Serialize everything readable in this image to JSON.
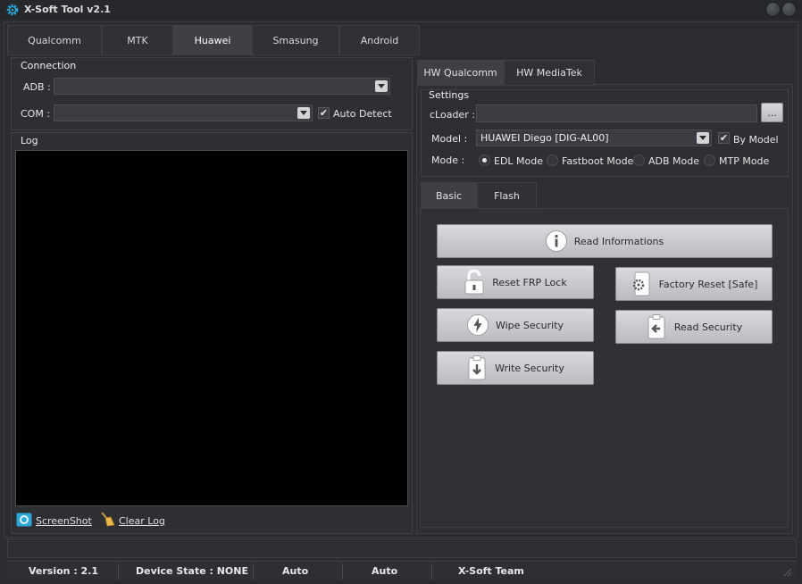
{
  "app": {
    "title": "X-Soft Tool v2.1"
  },
  "main_tabs": [
    {
      "label": "Qualcomm"
    },
    {
      "label": "MTK"
    },
    {
      "label": "Huawei",
      "active": true
    },
    {
      "label": "Smasung"
    },
    {
      "label": "Android"
    }
  ],
  "connection": {
    "title": "Connection",
    "adb_label": "ADB :",
    "adb_value": "",
    "com_label": "COM :",
    "com_value": "",
    "auto_detect_label": "Auto Detect",
    "auto_detect_checked": true
  },
  "log": {
    "title": "Log",
    "screenshot_label": "ScreenShot",
    "clear_label": "Clear Log"
  },
  "hw_tabs": [
    {
      "label": "HW Qualcomm",
      "active": true
    },
    {
      "label": "HW MediaTek"
    }
  ],
  "settings": {
    "title": "Settings",
    "cloader_label": "cLoader :",
    "cloader_value": "",
    "browse_label": "...",
    "model_label": "Model :",
    "model_value": "HUAWEI Diego [DIG-AL00]",
    "by_model_label": "By Model",
    "by_model_checked": true,
    "mode_label": "Mode :",
    "modes": [
      {
        "label": "EDL Mode",
        "selected": true
      },
      {
        "label": "Fastboot Mode",
        "selected": false
      },
      {
        "label": "ADB Mode",
        "selected": false
      },
      {
        "label": "MTP Mode",
        "selected": false
      }
    ]
  },
  "func_tabs": [
    {
      "label": "Basic",
      "active": true
    },
    {
      "label": "Flash"
    }
  ],
  "buttons": {
    "read_info": "Read Informations",
    "reset_frp": "Reset FRP Lock",
    "factory_reset": "Factory Reset [Safe]",
    "wipe_security": "Wipe Security",
    "read_security": "Read Security",
    "write_security": "Write Security"
  },
  "status": {
    "version": "Version : 2.1",
    "device_state": "Device State : NONE",
    "auto1": "Auto",
    "auto2": "Auto",
    "team": "X-Soft Team"
  },
  "colors": {
    "background": "#2b2d31",
    "log_background": "#000000",
    "button_face": "#c9cacd",
    "icon_accent": "#2aa6d8"
  }
}
